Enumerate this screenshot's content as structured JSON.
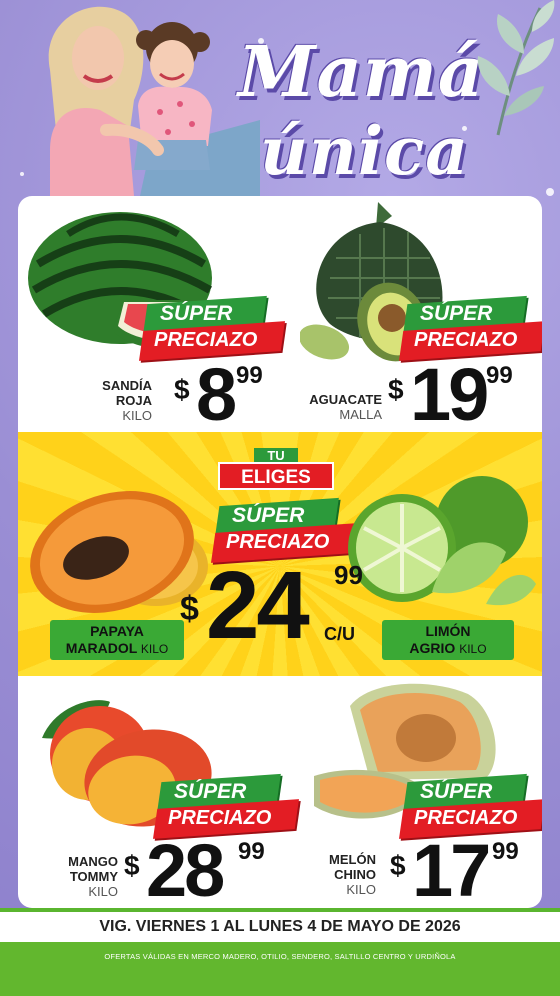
{
  "header": {
    "title_line1": "Mamá",
    "title_line2": "única"
  },
  "products": {
    "sandia": {
      "name_line1": "SANDÍA",
      "name_line2": "ROJA",
      "unit": "KILO",
      "currency": "$",
      "price_int": "8",
      "price_cents": "99"
    },
    "aguacate": {
      "name_line1": "AGUACATE",
      "unit": "MALLA",
      "currency": "$",
      "price_int": "19",
      "price_cents": "99"
    },
    "mango": {
      "name_line1": "MANGO",
      "name_line2": "TOMMY",
      "unit": "KILO",
      "currency": "$",
      "price_int": "28",
      "price_cents": "99"
    },
    "melon": {
      "name_line1": "MELÓN",
      "name_line2": "CHINO",
      "unit": "KILO",
      "currency": "$",
      "price_int": "17",
      "price_cents": "99"
    }
  },
  "featured": {
    "tu": "TU",
    "eliges": "ELIGES",
    "currency": "$",
    "price_int": "24",
    "price_cents": "99",
    "per_unit": "C/U",
    "left": {
      "name_line1": "PAPAYA",
      "name_line2": "MARADOL",
      "unit": "KILO"
    },
    "right": {
      "name_line1": "LIMÓN",
      "name_line2": "AGRIO",
      "unit": "KILO"
    }
  },
  "badge": {
    "line1": "SÚPER",
    "line2": "PRECIAZO"
  },
  "footer": {
    "validity": "VIG. VIERNES 1 AL LUNES 4 DE MAYO DE 2026",
    "note": "OFERTAS VÁLIDAS EN MERCO MADERO, OTILIO, SENDERO, SALTILLO CENTRO Y URDIÑOLA"
  },
  "colors": {
    "background": "#9b8fd6",
    "badge_green": "#2c9a3b",
    "badge_red": "#e31d24",
    "band_yellow": "#ffd21a",
    "footer_green": "#62b72e"
  },
  "icons": [
    "leaf-decoration",
    "watermelon",
    "avocado",
    "papaya",
    "lime",
    "mango",
    "cantaloupe"
  ]
}
